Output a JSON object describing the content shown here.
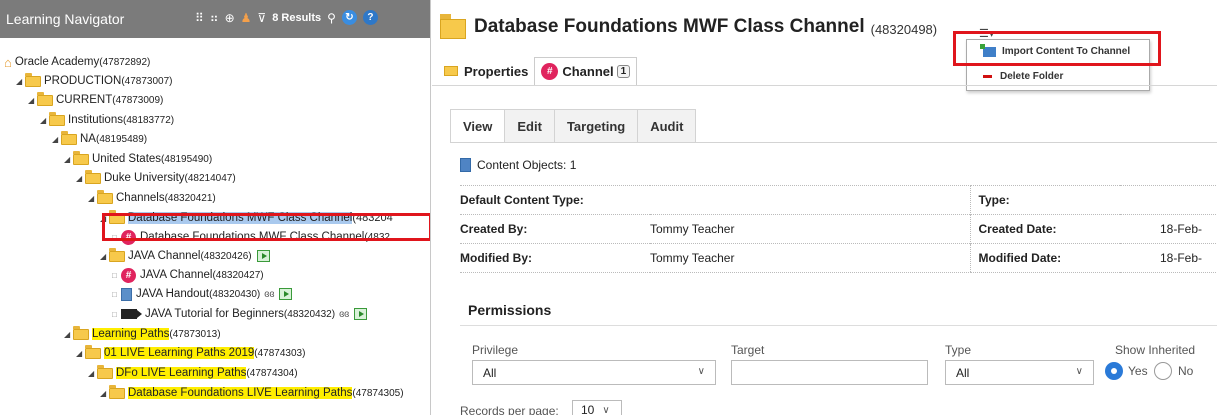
{
  "navigator": {
    "title": "Learning Navigator",
    "results": "8 Results",
    "tree": [
      {
        "label": "Oracle Academy",
        "id": "(47872892)"
      },
      {
        "label": "PRODUCTION",
        "id": "(47873007)"
      },
      {
        "label": "CURRENT",
        "id": "(47873009)"
      },
      {
        "label": "Institutions",
        "id": "(48183772)"
      },
      {
        "label": "NA",
        "id": "(48195489)"
      },
      {
        "label": "United States",
        "id": "(48195490)"
      },
      {
        "label": "Duke University",
        "id": "(48214047)"
      },
      {
        "label": "Channels",
        "id": "(48320421)"
      },
      {
        "label": "Database Foundations MWF Class Channel",
        "id": "(483204"
      },
      {
        "label": "Database Foundations MWF Class Channel",
        "id": "(4832"
      },
      {
        "label": "JAVA Channel",
        "id": "(48320426)"
      },
      {
        "label": "JAVA Channel",
        "id": "(48320427)"
      },
      {
        "label": "JAVA Handout",
        "id": "(48320430)"
      },
      {
        "label": "JAVA Tutorial for Beginners",
        "id": "(48320432)"
      },
      {
        "label": "Learning Paths",
        "id": "(47873013)"
      },
      {
        "label": "01 LIVE Learning Paths 2019",
        "id": "(47874303)"
      },
      {
        "label": "DFo LIVE Learning Paths",
        "id": "(47874304)"
      },
      {
        "label": "Database Foundations LIVE Learning Paths",
        "id": "(47874305)"
      }
    ]
  },
  "header": {
    "title": "Database Foundations MWF Class Channel",
    "title_id": "(48320498)"
  },
  "dropdown": {
    "import": "Import Content To Channel",
    "delete": "Delete Folder"
  },
  "top_tabs": {
    "properties": "Properties",
    "channel": "Channel",
    "channel_count": "1"
  },
  "inner_tabs": [
    "View",
    "Edit",
    "Targeting",
    "Audit"
  ],
  "content_objects": "Content Objects: 1",
  "info": {
    "default_content_type": "Default Content Type:",
    "type": "Type:",
    "created_by": "Created By:",
    "created_by_value": "Tommy Teacher",
    "created_date": "Created Date:",
    "created_date_value": "18-Feb-",
    "modified_by": "Modified By:",
    "modified_by_value": "Tommy Teacher",
    "modified_date": "Modified Date:",
    "modified_date_value": "18-Feb-"
  },
  "permissions": {
    "title": "Permissions",
    "privilege_label": "Privilege",
    "privilege_value": "All",
    "target_label": "Target",
    "type_label": "Type",
    "type_value": "All",
    "show_inherited_label": "Show Inherited",
    "yes": "Yes",
    "no": "No",
    "records_label": "Records per page:",
    "records_value": "10"
  }
}
